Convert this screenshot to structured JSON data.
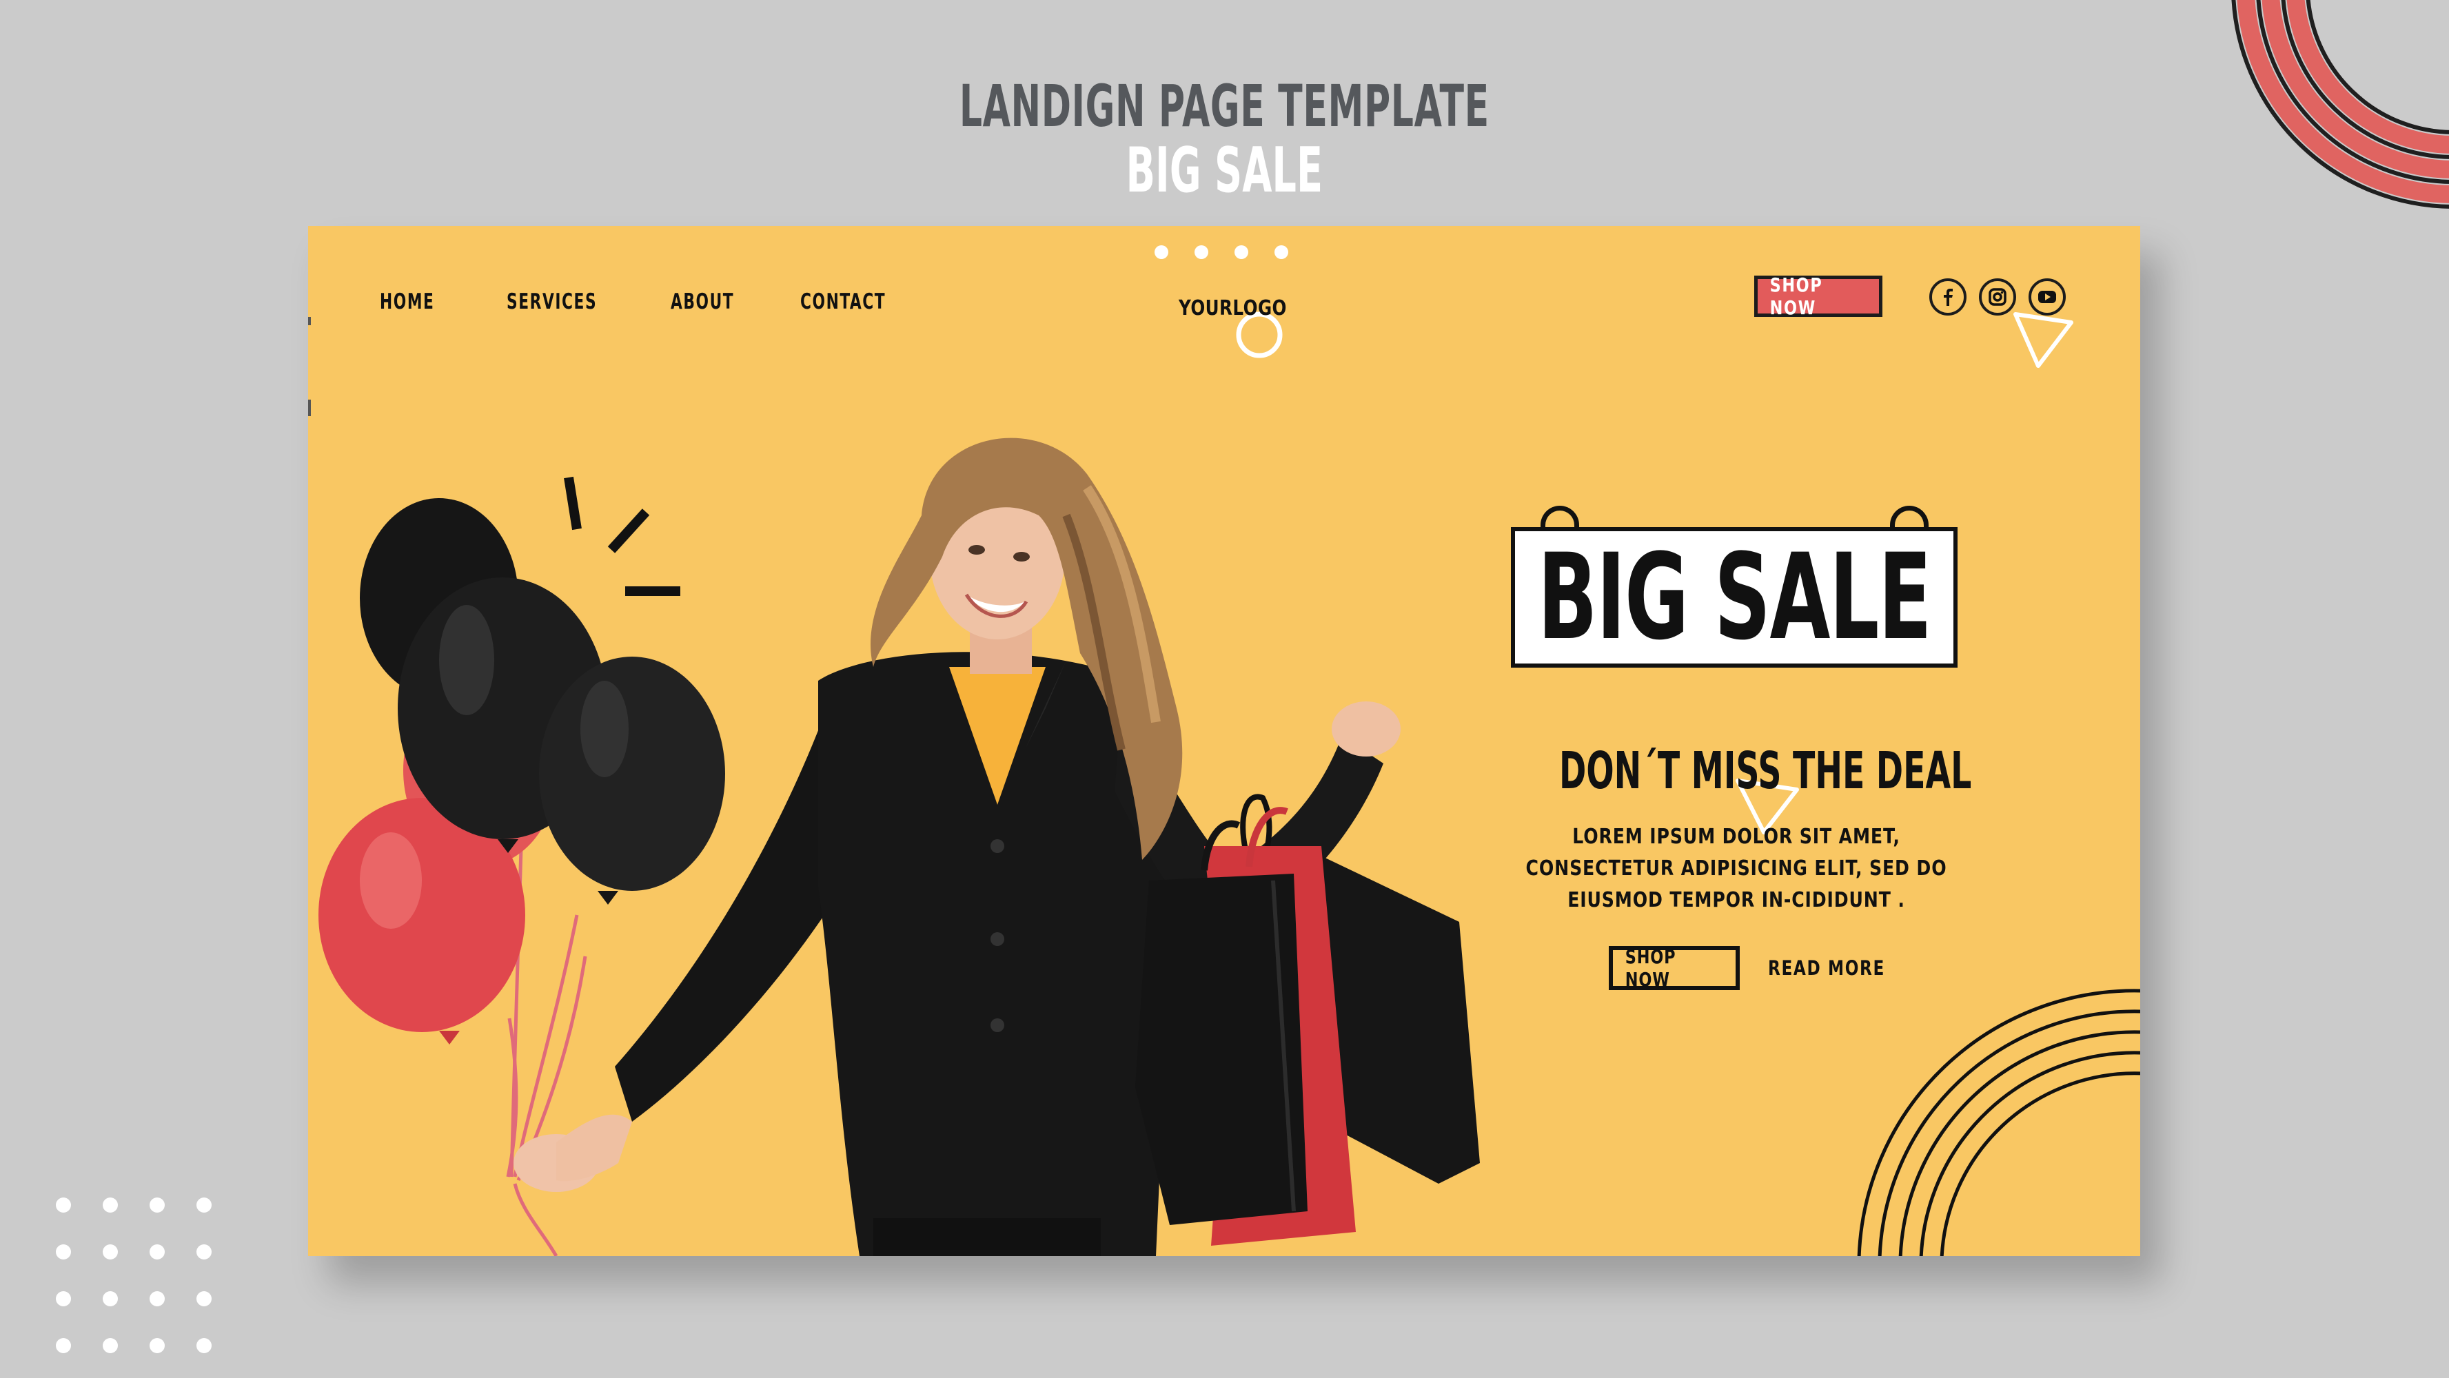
{
  "page_header": {
    "line1": "LANDIGN PAGE TEMPLATE",
    "line2": "BIG SALE"
  },
  "nav": {
    "items": [
      "HOME",
      "SERVICES",
      "ABOUT",
      "CONTACT"
    ]
  },
  "logo": "YOURLOGO",
  "header_cta": "SHOP NOW",
  "social": {
    "icons": [
      "facebook-icon",
      "instagram-icon",
      "youtube-icon"
    ]
  },
  "hero": {
    "sign_text": "BIG SALE",
    "headline": "DON´T MISS THE DEAL",
    "body": "LOREM IPSUM DOLOR SIT AMET, CONSECTETUR ADIPISICING ELIT, SED DO EIUSMOD TEMPOR IN-CIDIDUNT .",
    "primary_button": "SHOP NOW",
    "secondary_link": "READ MORE"
  },
  "colors": {
    "background": "#cbcbcb",
    "card": "#f9c763",
    "accent_red": "#e25b5b",
    "ink": "#111111",
    "white": "#ffffff"
  }
}
